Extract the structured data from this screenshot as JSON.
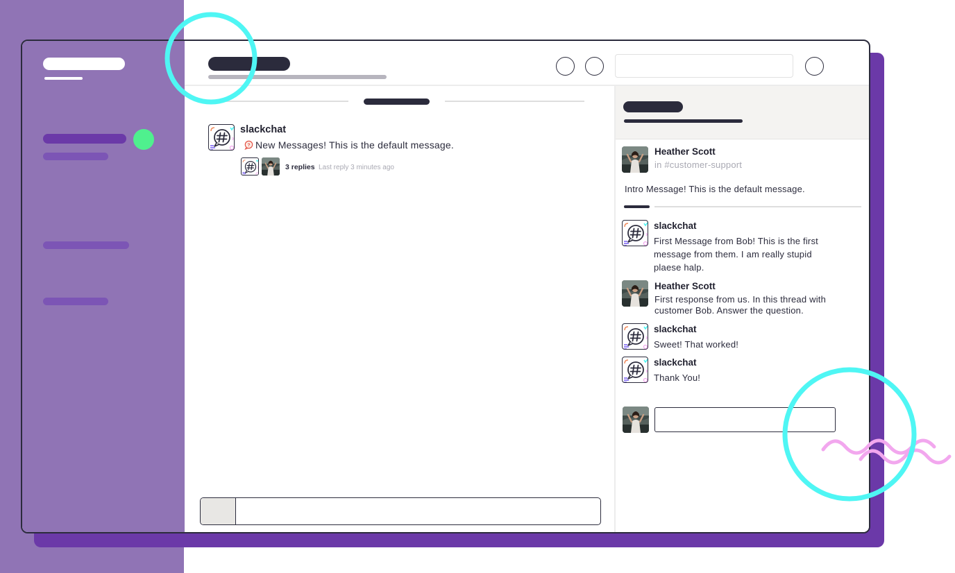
{
  "colors": {
    "sidebar_purple": "#9074b5",
    "shadow_purple": "#6b39a8",
    "online_green": "#4ff08e",
    "dark": "#2b2b3c",
    "accent_cyan": "#4ff6f4",
    "accent_pink": "#f2a7ee"
  },
  "channel": {
    "message": {
      "author": "slackchat",
      "text": "New Messages! This is the default message.",
      "reply_count": "3 replies",
      "last_reply": "Last reply 3 minutes ago"
    },
    "composer": {
      "placeholder": ""
    }
  },
  "thread": {
    "parent": {
      "author": "Heather Scott",
      "channel": "in #customer-support",
      "text": "Intro Message! This is the default message."
    },
    "replies": [
      {
        "author": "slackchat",
        "text": "First Message from Bob! This is the first message from them. I am really stupid plaese halp.",
        "avatar": "slackchat-logo"
      },
      {
        "author": "Heather Scott",
        "text": "First response from us. In this thread with customer Bob. Answer the question.",
        "avatar": "user-photo"
      },
      {
        "author": "slackchat",
        "text": "Sweet! That worked!",
        "avatar": "slackchat-logo"
      },
      {
        "author": "slackchat",
        "text": "Thank You!",
        "avatar": "slackchat-logo"
      }
    ],
    "reply_placeholder": ""
  }
}
